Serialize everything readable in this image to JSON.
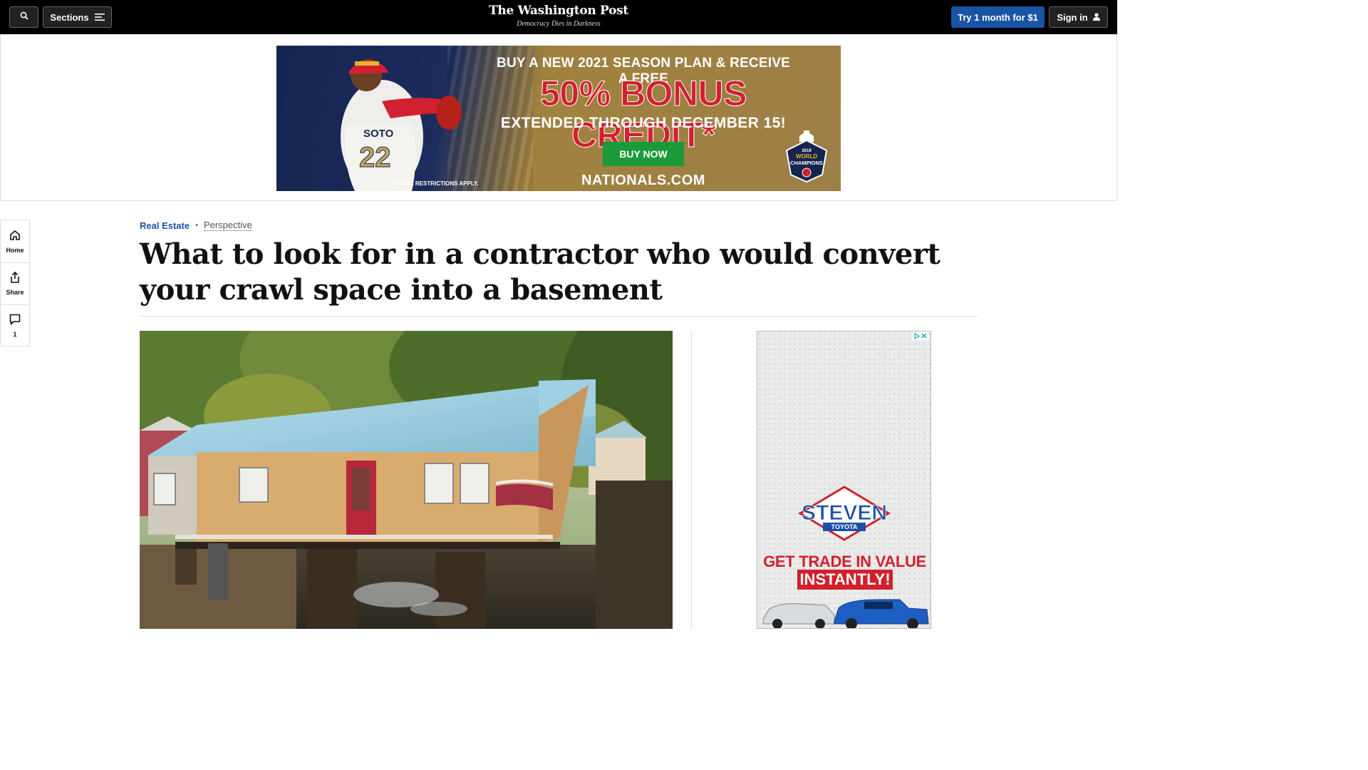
{
  "header": {
    "search_icon": "search-icon",
    "sections_label": "Sections",
    "masthead_logo": "The Washington Post",
    "masthead_tagline": "Democracy Dies in Darkness",
    "try_label": "Try 1 month for $1",
    "signin_label": "Sign in"
  },
  "top_ad": {
    "line1": "BUY A NEW 2021 SEASON PLAN & RECEIVE A FREE",
    "line2": "50% BONUS CREDIT*",
    "line3": "EXTENDED THROUGH DECEMBER 15!",
    "button": "BUY NOW",
    "restrictions": "*SOME RESTRICTIONS APPLY.",
    "site": "NATIONALS.COM",
    "badge_year": "2019",
    "badge_line1": "WORLD",
    "badge_line2": "CHAMPIONS",
    "jersey_name": "SOTO",
    "jersey_number": "22",
    "colors": {
      "navy": "#16244f",
      "gold": "#a0813e",
      "red": "#d22030",
      "green": "#1a9a3a"
    }
  },
  "rail": {
    "home_label": "Home",
    "share_label": "Share",
    "comments_count": "1"
  },
  "article": {
    "section": "Real Estate",
    "separator": "•",
    "label": "Perspective",
    "headline": "What to look for in a contractor who would convert your crawl space into a basement"
  },
  "right_ad": {
    "brand": "STEVEN",
    "brand_sub": "TOYOTA",
    "line1": "GET TRADE IN VALUE",
    "line2": "INSTANTLY!",
    "colors": {
      "red": "#d2202c",
      "blue": "#1a4fa8"
    }
  },
  "accent_color": "#1955a5"
}
